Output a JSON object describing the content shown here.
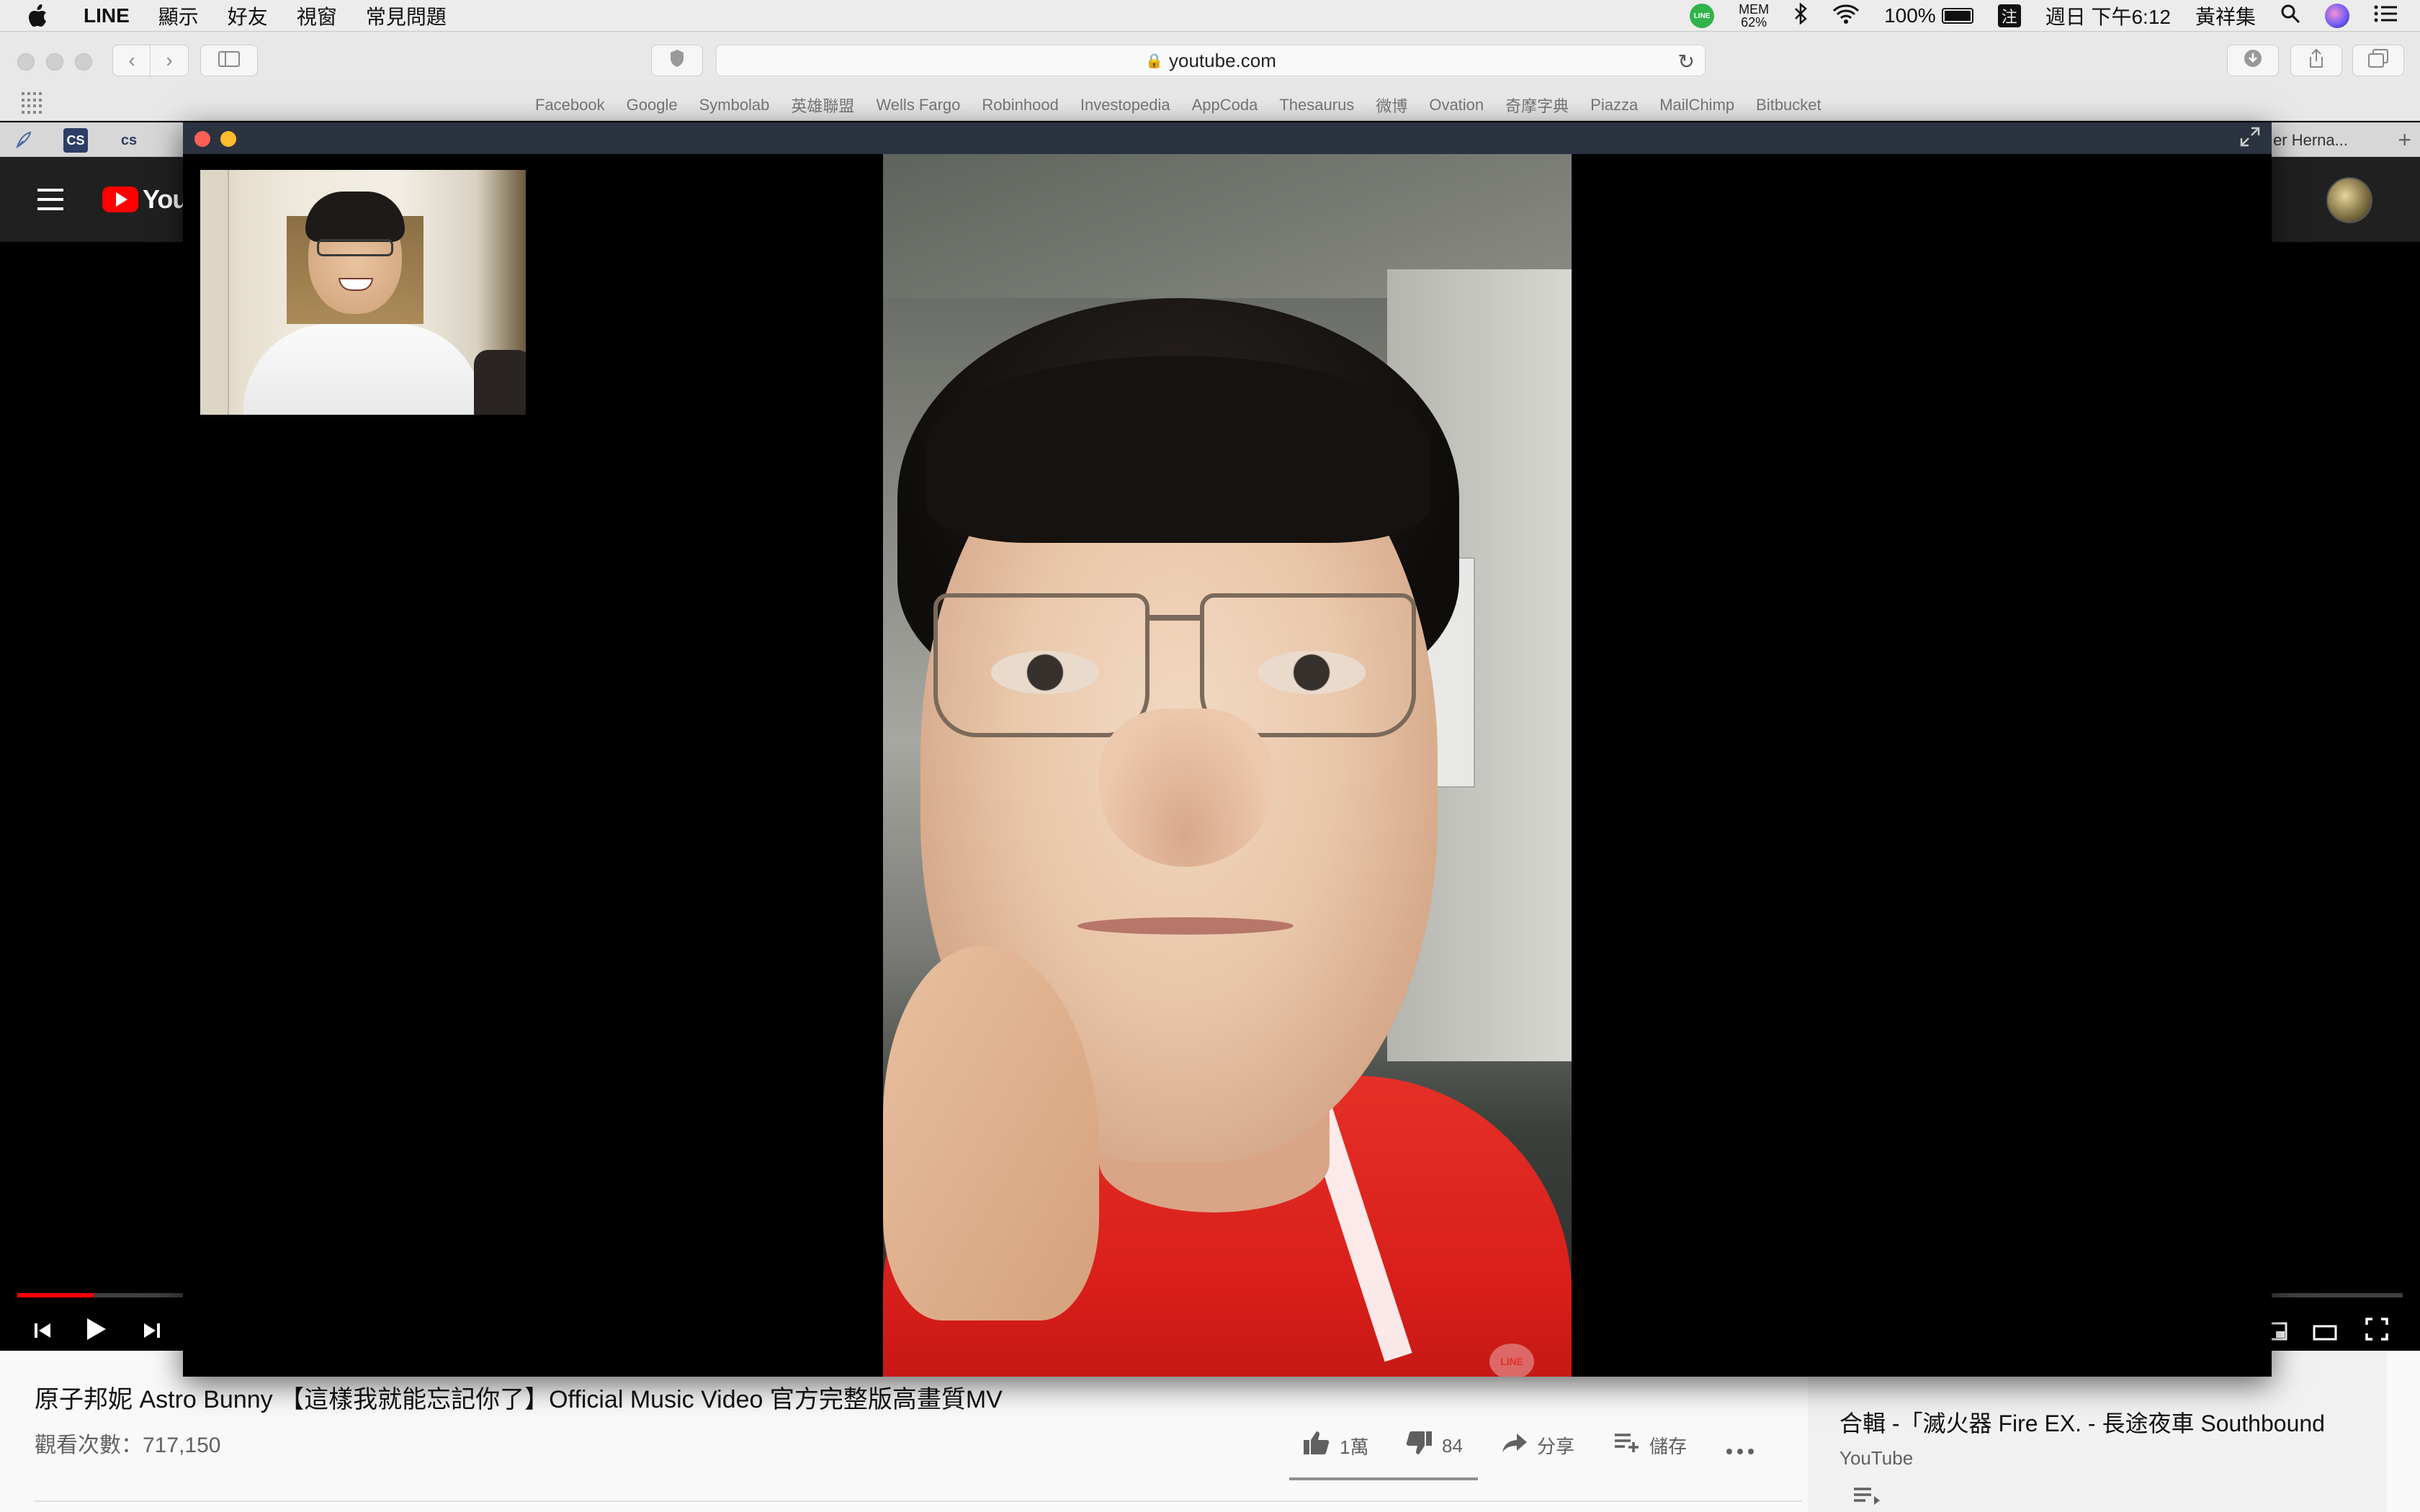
{
  "menubar": {
    "app_name": "LINE",
    "items": [
      "顯示",
      "好友",
      "視窗",
      "常見問題"
    ],
    "line_status": "LINE",
    "mem_label": "MEM",
    "mem_value": "62%",
    "battery": "100%",
    "ime": "注",
    "datetime": "週日 下午6:12",
    "user": "黃祥集"
  },
  "safari": {
    "url": "youtube.com",
    "bookmarks": [
      "Facebook",
      "Google",
      "Symbolab",
      "英雄聯盟",
      "Wells Fargo",
      "Robinhood",
      "Investopedia",
      "AppCoda",
      "Thesaurus",
      "微博",
      "Ovation",
      "奇摩字典",
      "Piazza",
      "MailChimp",
      "Bitbucket"
    ],
    "tab_fav_2": "CS",
    "tab_fav_3": "cs",
    "tab_right_label": "er Herna..."
  },
  "youtube": {
    "logo_text": "YouT",
    "video_title": "原子邦妮 Astro Bunny 【這樣我就能忘記你了】Official Music Video 官方完整版高畫質MV",
    "views": "觀看次數：717,150",
    "progress": 0.032,
    "actions": {
      "like_count": "1萬",
      "dislike_count": "84",
      "share_label": "分享",
      "save_label": "儲存"
    },
    "sidebar": {
      "title": "合輯 -「滅火器 Fire EX. - 長途夜車 Southbound",
      "channel": "YouTube"
    }
  },
  "line_call": {
    "watermark": "LINE"
  },
  "colors": {
    "youtube_red": "#ff0000",
    "line_green": "#2fb34a",
    "close_red": "#ff5f57",
    "minimize_yellow": "#febc2e"
  }
}
